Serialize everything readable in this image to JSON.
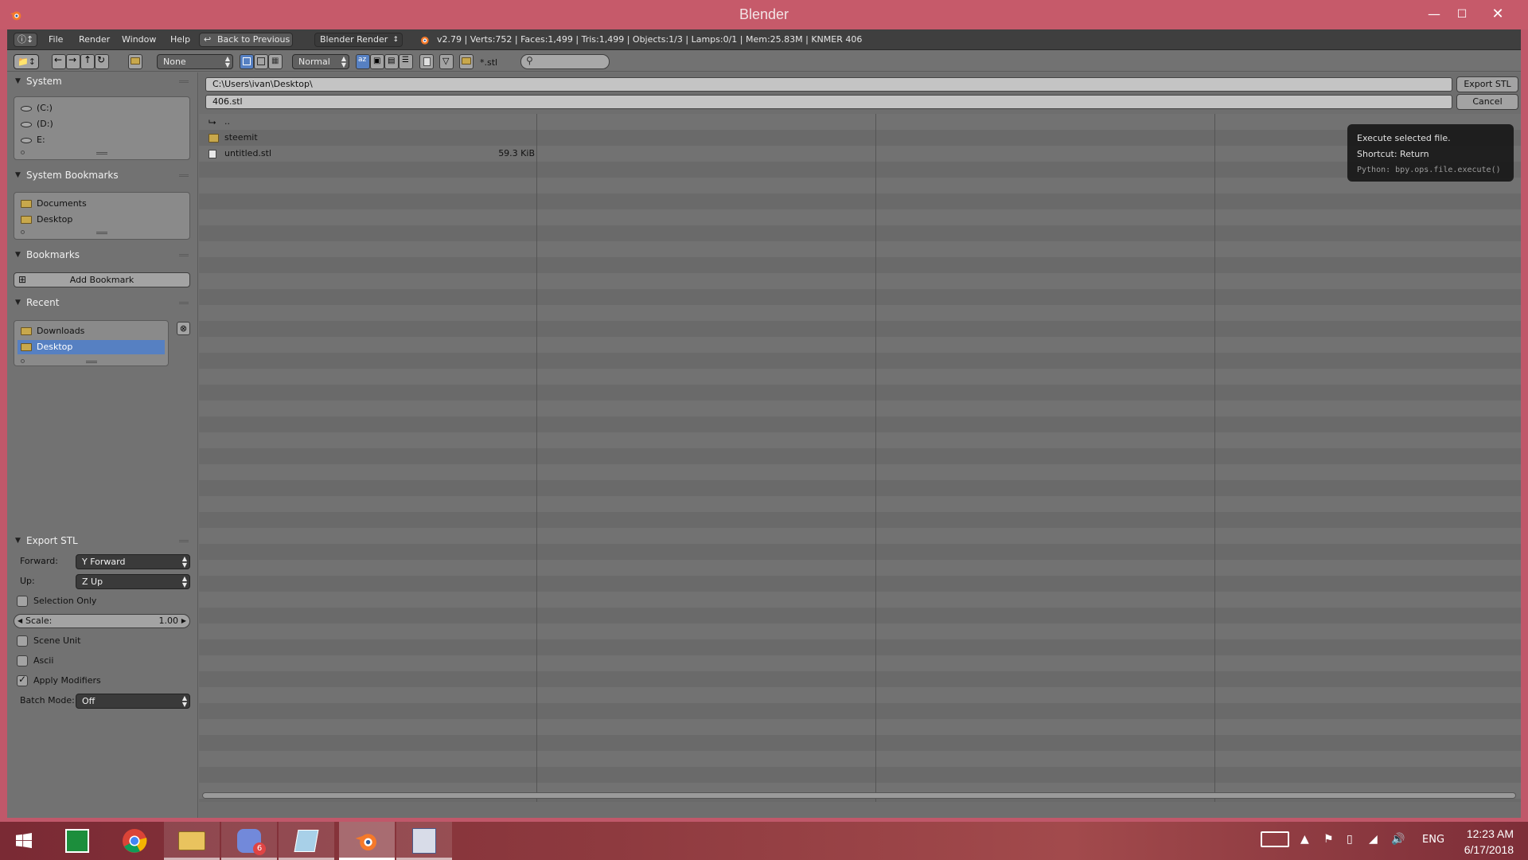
{
  "window": {
    "title": "Blender"
  },
  "topbar": {
    "menu": [
      "File",
      "Render",
      "Window",
      "Help"
    ],
    "back_button": "Back to Previous",
    "render_engine": "Blender Render",
    "stats": "v2.79 | Verts:752 | Faces:1,499 | Tris:1,499 | Objects:1/3 | Lamps:0/1 | Mem:25.83M | KNMER 406"
  },
  "fbheader": {
    "recursion": "None",
    "display_size": "Normal",
    "filter_glob": "*.stl",
    "search_placeholder": ""
  },
  "sidebar": {
    "system": {
      "title": "System",
      "items": [
        "(C:)",
        "(D:)",
        "E:"
      ]
    },
    "system_bookmarks": {
      "title": "System Bookmarks",
      "items": [
        "Documents",
        "Desktop"
      ]
    },
    "bookmarks": {
      "title": "Bookmarks",
      "add_label": "Add Bookmark"
    },
    "recent": {
      "title": "Recent",
      "items": [
        "Downloads",
        "Desktop"
      ],
      "selected": "Desktop"
    }
  },
  "export": {
    "title": "Export STL",
    "forward_label": "Forward:",
    "forward_value": "Y Forward",
    "up_label": "Up:",
    "up_value": "Z Up",
    "selection_only": "Selection Only",
    "scale_label": "Scale:",
    "scale_value": "1.00",
    "scene_unit": "Scene Unit",
    "ascii": "Ascii",
    "apply_modifiers": "Apply Modifiers",
    "apply_modifiers_checked": true,
    "batch_label": "Batch Mode:",
    "batch_value": "Off"
  },
  "filebrowser": {
    "path": "C:\\Users\\ivan\\Desktop\\",
    "filename": "406.stl",
    "export_button": "Export STL",
    "cancel_button": "Cancel",
    "files": [
      {
        "name": "..",
        "type": "parent",
        "size": ""
      },
      {
        "name": "steemit",
        "type": "folder",
        "size": ""
      },
      {
        "name": "untitled.stl",
        "type": "file",
        "size": "59.3 KiB"
      }
    ]
  },
  "tooltip": {
    "title": "Execute selected file.",
    "shortcut": "Shortcut: Return",
    "python": "Python: bpy.ops.file.execute()"
  },
  "taskbar": {
    "discord_badge": "6",
    "lang": "ENG",
    "time": "12:23 AM",
    "date": "6/17/2018"
  },
  "colors": {
    "accent": "#5680c2",
    "titlebar": "#c65a6a",
    "panel": "#727272"
  }
}
